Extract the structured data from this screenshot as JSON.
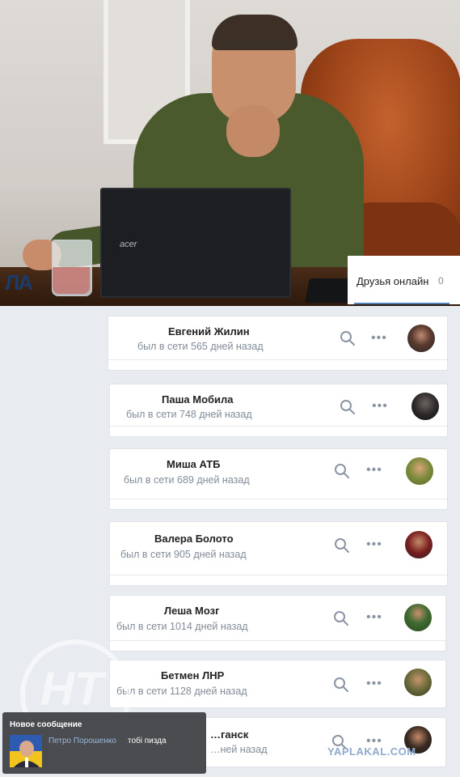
{
  "photo": {
    "laptop_brand": "acer",
    "channel_logo": "ЛА"
  },
  "friends_tab": {
    "label": "Друзья онлайн",
    "count": "0"
  },
  "friends": [
    {
      "name": "Евгений Жилин",
      "status": "был в сети 565 дней назад"
    },
    {
      "name": "Паша Мобила",
      "status": "был в сети 748 дней назад"
    },
    {
      "name": "Миша АТБ",
      "status": "был в сети 689 дней назад"
    },
    {
      "name": "Валера Болото",
      "status": "был в сети 905 дней назад"
    },
    {
      "name": "Леша Мозг",
      "status": "был в сети 1014 дней назад"
    },
    {
      "name": "Бетмен ЛНР",
      "status": "был в сети 1128 дней назад"
    },
    {
      "name": "…ганск",
      "status": "…ней назад"
    }
  ],
  "icons": {
    "search": "search-icon",
    "more": "more-icon"
  },
  "actions": {
    "more_glyph": "•••"
  },
  "notification": {
    "title": "Новое сообщение",
    "sender": "Петро Порошенко",
    "text": "тобі пизда"
  },
  "watermark": {
    "site": "YAPLAKAL.COM",
    "mark": "НТ"
  },
  "colors": {
    "accent": "#5181b8",
    "status_gray": "#818c99",
    "page_bg": "#e8ebef"
  }
}
